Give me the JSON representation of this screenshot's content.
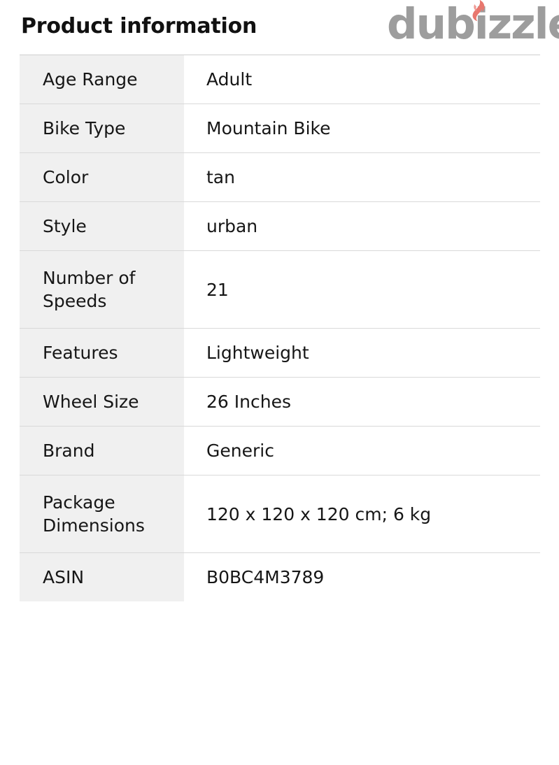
{
  "header": {
    "title": "Product information",
    "brand": {
      "wordmark": "dubizzle",
      "icon": "flame-icon",
      "text_color": "#9d9d9d",
      "flame_color": "#e8776e"
    }
  },
  "spec_table": {
    "label_column_bg": "#f0f0f0",
    "value_column_bg": "#ffffff",
    "row_divider_color": "#d9d9d9",
    "rows": [
      {
        "label": "Age Range",
        "value": "Adult",
        "tall": false
      },
      {
        "label": "Bike Type",
        "value": "Mountain Bike",
        "tall": false
      },
      {
        "label": "Color",
        "value": "tan",
        "tall": false
      },
      {
        "label": "Style",
        "value": "urban",
        "tall": false
      },
      {
        "label": "Number of Speeds",
        "value": "21",
        "tall": true
      },
      {
        "label": "Features",
        "value": "Lightweight",
        "tall": false
      },
      {
        "label": "Wheel Size",
        "value": "26 Inches",
        "tall": false
      },
      {
        "label": "Brand",
        "value": "Generic",
        "tall": false
      },
      {
        "label": "Package Dimensions",
        "value": "120 x 120 x 120 cm; 6 kg",
        "tall": true
      },
      {
        "label": "ASIN",
        "value": "B0BC4M3789",
        "tall": false
      }
    ]
  }
}
